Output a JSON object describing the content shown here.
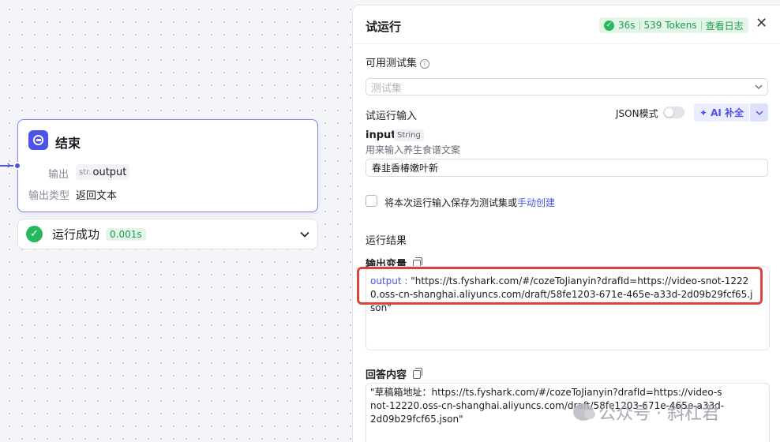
{
  "canvas": {
    "node": {
      "title": "结束",
      "output_label": "输出",
      "output_type": "str.",
      "output_name": "output",
      "output_kind_label": "输出类型",
      "output_kind_value": "返回文本"
    },
    "run_status": {
      "text": "运行成功",
      "duration": "0.001s"
    }
  },
  "panel": {
    "title": "试运行",
    "badge": {
      "time": "36s",
      "tokens": "539 Tokens",
      "log_link": "查看日志",
      "color": "#1f9c4f"
    },
    "close_icon": "✕",
    "testset_label": "可用测试集",
    "testset_placeholder": "测试集",
    "run_input_label": "试运行输入",
    "json_mode_label": "JSON模式",
    "json_mode_on": false,
    "ai_button_label": "AI 补全",
    "input": {
      "name": "input",
      "type": "String",
      "description": "用来输入养生食谱文案",
      "value": "春韭香椿嫩叶新"
    },
    "save_text": "将本次运行输入保存为测试集或",
    "save_link": "手动创建",
    "result_label": "运行结果",
    "output_var_label": "输出变量",
    "output_key": "output",
    "output_value": "\"https://ts.fyshark.com/#/cozeToJianyin?drafId=https://video-snot-12220.oss-cn-shanghai.aliyuncs.com/draft/58fe1203-671e-465e-a33d-2d09b29fcf65.json\"",
    "answer_label": "回答内容",
    "answer_value": "\"草稿箱地址：https://ts.fyshark.com/#/cozeToJianyin?drafId=https://video-snot-12220.oss-cn-shanghai.aliyuncs.com/draft/58fe1203-671e-465e-a33d-2d09b29fcf65.json\""
  },
  "watermark": "公众号 · 斜杠君",
  "colors": {
    "accent": "#4d53e8",
    "success": "#26b85f",
    "highlight": "#d9443b"
  }
}
